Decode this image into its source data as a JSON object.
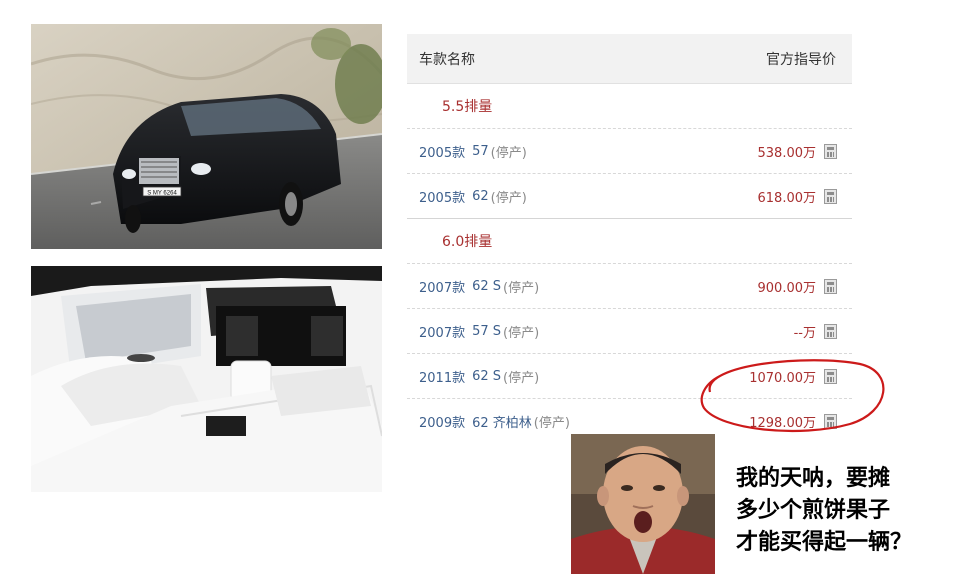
{
  "license_plate": "S MY 6264",
  "table": {
    "header": {
      "model_col": "车款名称",
      "price_col": "官方指导价"
    },
    "groups": [
      {
        "label": "5.5排量",
        "rows": [
          {
            "year": "2005款",
            "code": "57",
            "status": "(停产)",
            "price": "538.00万"
          },
          {
            "year": "2005款",
            "code": "62",
            "status": "(停产)",
            "price": "618.00万"
          }
        ]
      },
      {
        "label": "6.0排量",
        "rows": [
          {
            "year": "2007款",
            "code": "62 S",
            "status": "(停产)",
            "price": "900.00万"
          },
          {
            "year": "2007款",
            "code": "57 S",
            "status": "(停产)",
            "price": "--万"
          },
          {
            "year": "2011款",
            "code": "62 S",
            "status": "(停产)",
            "price": "1070.00万"
          },
          {
            "year": "2009款",
            "code": "62 齐柏林",
            "status": "(停产)",
            "price": "1298.00万"
          }
        ]
      }
    ]
  },
  "meme": {
    "caption_lines": [
      "我的天呐，要摊",
      "多少个煎饼果子",
      "才能买得起一辆？"
    ]
  },
  "colors": {
    "price_red": "#a83030",
    "link_blue": "#3d5f8c",
    "annotation_red": "#cc1a1a"
  }
}
